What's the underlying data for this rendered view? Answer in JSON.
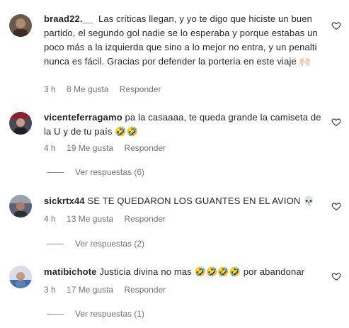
{
  "comments": [
    {
      "username": "braad22.__",
      "text": "Las críticas llegan, y yo te digo que hiciste un buen partido, el segundo gol nadie se lo esperaba y porque estabas un poco más a la izquierda que sino a lo mejor no entra, y un penalti nunca es fácil. Gracias por defender la portería en este viaje 🙌🏻",
      "time": "3 h",
      "likes": "8 Me gusta",
      "reply": "Responder"
    },
    {
      "username": "vicenteferragamo",
      "text": "pa la casaaaa, te queda grande la camiseta de la U y de tu país 🤣🤣",
      "time": "4 h",
      "likes": "19 Me gusta",
      "reply": "Responder",
      "view_replies": "Ver respuestas (6)"
    },
    {
      "username": "sickrtx44",
      "text": "SE TE QUEDARON LOS GUANTES EN EL AVION 💀",
      "time": "4 h",
      "likes": "13 Me gusta",
      "reply": "Responder",
      "view_replies": "Ver respuestas (2)"
    },
    {
      "username": "matibichote",
      "text": "Justicia divina no mas 🤣🤣🤣🤣 por abandonar",
      "time": "3 h",
      "likes": "17 Me gusta",
      "reply": "Responder",
      "view_replies": "Ver respuestas (1)"
    }
  ],
  "icons": {
    "like": "heart-outline-icon"
  },
  "colors": {
    "text": "#262626",
    "secondary": "#737373"
  }
}
